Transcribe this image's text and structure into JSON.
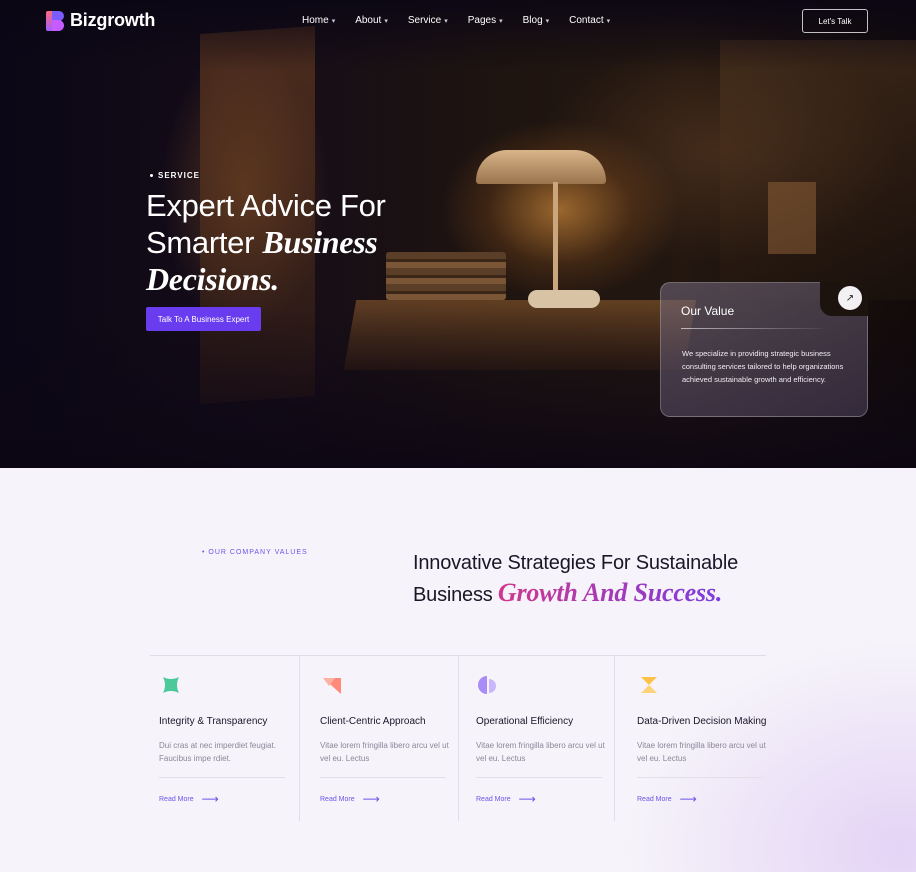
{
  "brand": {
    "name": "Bizgrowth"
  },
  "nav": {
    "items": [
      {
        "label": "Home"
      },
      {
        "label": "About"
      },
      {
        "label": "Service"
      },
      {
        "label": "Pages"
      },
      {
        "label": "Blog"
      },
      {
        "label": "Contact"
      }
    ],
    "cta_label": "Let's Talk"
  },
  "hero": {
    "eyebrow": "SERVICE",
    "title_line1": "Expert Advice For",
    "title_line2_plain": "Smarter ",
    "title_line2_italic": "Business",
    "title_line3_italic": "Decisions.",
    "cta_label": "Talk To A Business Expert"
  },
  "value_card": {
    "title": "Our Value",
    "text": "We specialize in providing strategic business consulting services tailored to help organizations achieved sustainable growth and efficiency.",
    "arrow_icon": "arrow-up-right-icon"
  },
  "values_section": {
    "eyebrow": "OUR COMPANY VALUES",
    "title_line1": "Innovative Strategies For Sustainable",
    "title_line2_plain": "Business ",
    "title_line2_italic": "Growth And Success.",
    "cards": [
      {
        "icon": "integrity-icon",
        "title": "Integrity & Transparency",
        "desc": "Dui cras at nec imperdiet feugiat. Faucibus impe rdiet.",
        "link": "Read More",
        "color": "#4cc99a"
      },
      {
        "icon": "client-icon",
        "title": "Client-Centric Approach",
        "desc": "Vitae lorem fringilla libero arcu vel ut vel eu. Lectus",
        "link": "Read More",
        "color": "#ff8a7a"
      },
      {
        "icon": "efficiency-icon",
        "title": "Operational Efficiency",
        "desc": "Vitae lorem fringilla libero arcu vel ut vel eu. Lectus",
        "link": "Read More",
        "color": "#a98cf5"
      },
      {
        "icon": "data-icon",
        "title": "Data-Driven Decision Making",
        "desc": "Vitae lorem fringilla libero arcu vel ut vel eu. Lectus",
        "link": "Read More",
        "color": "#ffc14a"
      }
    ]
  },
  "colors": {
    "accent": "#6a3cf0",
    "link": "#6a55e8",
    "text_dark": "#1a1628"
  }
}
